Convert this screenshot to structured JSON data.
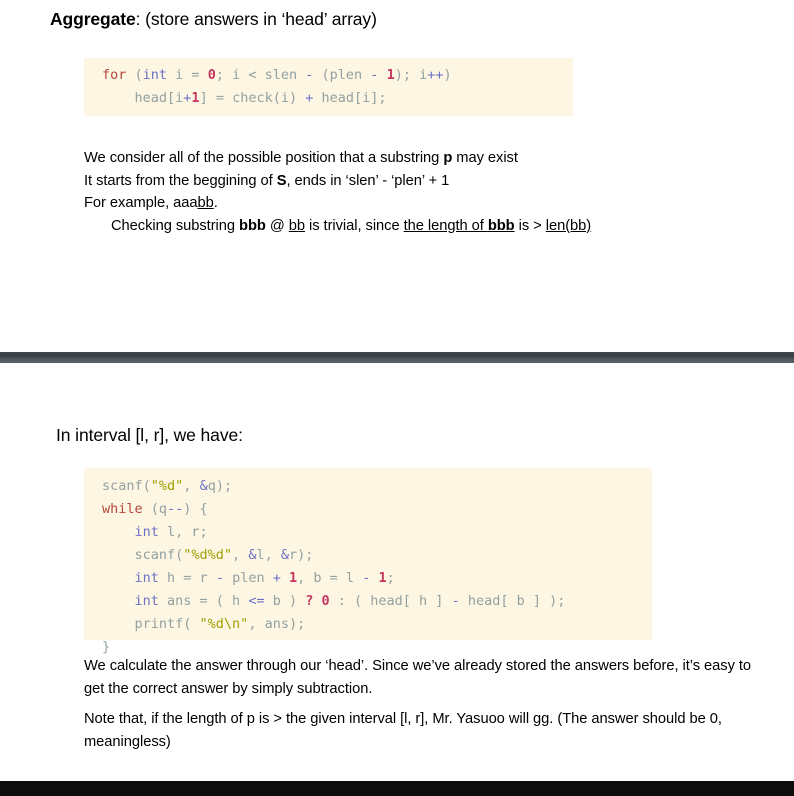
{
  "slide1": {
    "heading": {
      "bold_part": "Aggregate",
      "rest": ": (store answers in ‘head’ array)"
    },
    "code": {
      "language": "c",
      "lines": [
        "for (int i = 0; i < slen - (plen - 1); i++)",
        "    head[i+1] = check(i) + head[i];"
      ],
      "tokens": {
        "keyword_for": "for",
        "type_int": "int",
        "num_zero": "0",
        "num_one": "1"
      }
    },
    "paragraph": {
      "line1_a": "We consider all of the possible position that a substring ",
      "line1_b": "p",
      "line1_c": " may exist",
      "line2_a": "It starts from the beggining of ",
      "line2_b": "S",
      "line2_c": ", ends in ‘slen’ - ‘plen’ + 1",
      "line3_a": "For example, aaa",
      "line3_b": "bb",
      "line3_c": ".",
      "line4_a": "Checking substring ",
      "line4_b": "bbb",
      "line4_c": " @ ",
      "line4_d": "bb",
      "line4_e": " is trivial, since ",
      "line4_f": "the length of ",
      "line4_g": "bbb",
      "line4_h": " is > ",
      "line4_i": "len(bb)"
    }
  },
  "slide2": {
    "heading": "In interval [l, r], we have:",
    "code": {
      "language": "c",
      "lines": [
        "scanf(\"%d\", &q);",
        "while (q--) {",
        "    int l, r;",
        "    scanf(\"%d%d\", &l, &r);",
        "    int h = r - plen + 1, b = l - 1;",
        "    int ans = ( h <= b ) ? 0 : ( head[ h ] - head[ b ] );",
        "    printf( \"%d\\n\", ans);",
        "}"
      ],
      "tokens": {
        "keyword_while": "while",
        "type_int": "int",
        "str_d": "\"%d\"",
        "str_dd": "\"%d%d\"",
        "str_dn": "\"%d\\n\"",
        "num_one": "1",
        "num_zero": "0",
        "ternary_q": "?"
      }
    },
    "paragraph": {
      "para1": "We calculate the answer through our ‘head’. Since we’ve already stored the answers before, it’s easy to get the correct answer by simply subtraction.",
      "para2": "Note that, if the length of p is > the given interval [l, r], Mr. Yasuoo will gg. (The answer should be 0, meaningless)"
    }
  },
  "theme": {
    "page_background": "#ffffff",
    "code_background": "#fdf6e3",
    "code_plain": "#93a1a1",
    "code_keyword": "#b5463a",
    "code_type": "#6c71c4",
    "code_number": "#c7365f",
    "code_string": "#a0a005",
    "divider": "#41474b",
    "bottom_bar": "#0d0d0d",
    "text": "#000000"
  }
}
